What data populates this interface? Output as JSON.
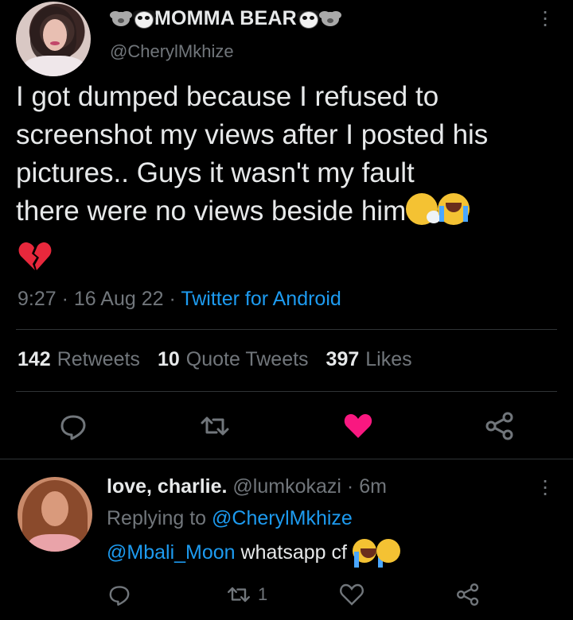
{
  "tweet": {
    "display_name": "MOMMA BEAR",
    "handle": "@CherylMkhize",
    "text_line1": "I got dumped because I refused to",
    "text_line2": "screenshot my views after I posted his",
    "text_line3": "pictures.. Guys it wasn't my fault",
    "text_line4": "there were no views beside him",
    "time": "9:27",
    "date": "16 Aug 22",
    "source": "Twitter for Android",
    "sep": "·",
    "retweets_count": "142",
    "retweets_label": "Retweets",
    "quotes_count": "10",
    "quotes_label": "Quote Tweets",
    "likes_count": "397",
    "likes_label": "Likes",
    "icons": [
      "bear-icon",
      "panda-icon",
      "sneezing-face-emoji",
      "loudly-crying-face-emoji",
      "broken-heart-emoji",
      "reply-icon",
      "retweet-icon",
      "like-icon",
      "share-icon",
      "more-icon"
    ],
    "like_color": "#f91880"
  },
  "reply": {
    "display_name": "love, charlie.",
    "handle": "@lumkokazi",
    "age": "6m",
    "replying_prefix": "Replying to",
    "replying_to": "@CherylMkhize",
    "mention": "@Mbali_Moon",
    "text": "whatsapp cf",
    "retweet_count": "1"
  },
  "colors": {
    "background": "#000000",
    "text": "#e7e9ea",
    "muted": "#71767b",
    "link": "#1d9bf0",
    "divider": "#2f3336"
  }
}
